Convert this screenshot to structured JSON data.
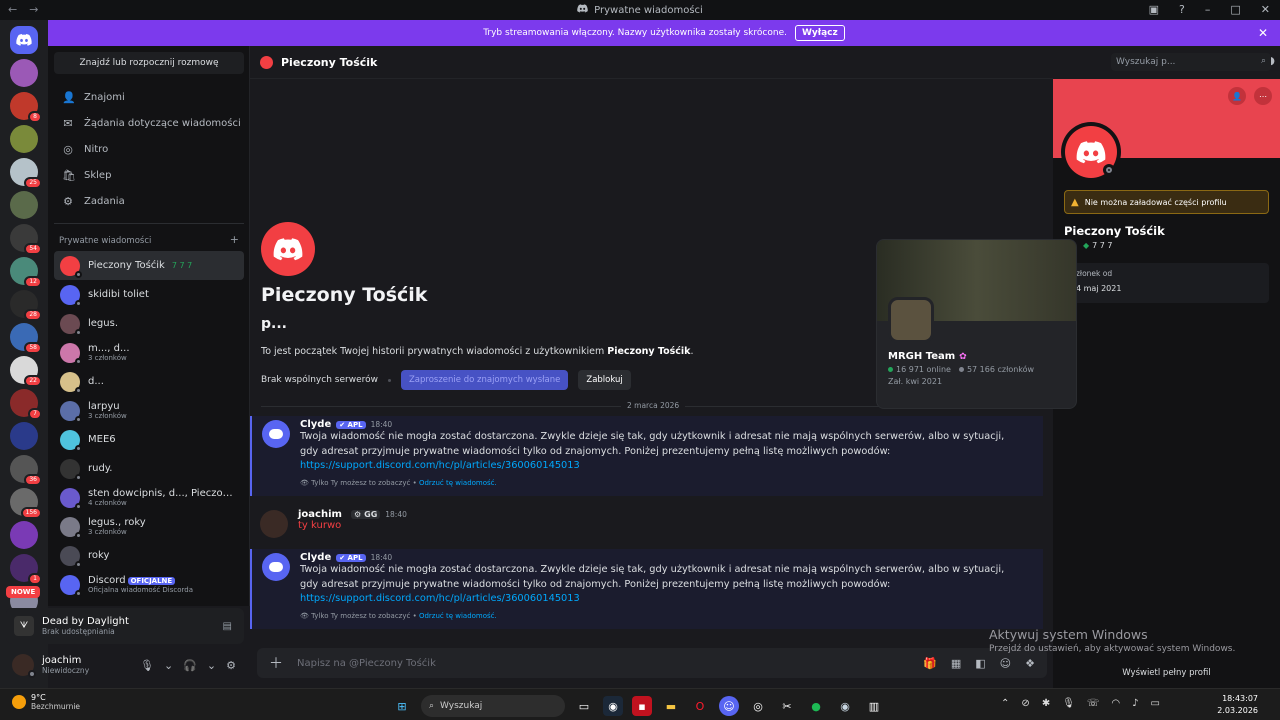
{
  "window": {
    "title": "Prywatne wiadomości"
  },
  "banner": {
    "text": "Tryb streamowania włączony. Nazwy użytkownika zostały skrócone.",
    "button": "Wyłącz"
  },
  "guild_badges": [
    "",
    "8",
    "",
    "25",
    "",
    "54",
    "12",
    "28",
    "58",
    "22",
    "7",
    "",
    "36",
    "156",
    "",
    "1",
    "",
    ""
  ],
  "new_badge": "NOWE",
  "dm_search": "Znajdź lub rozpocznij rozmowę",
  "dm_nav": [
    {
      "label": "Znajomi",
      "icon": "friends-icon",
      "glyph": "👤"
    },
    {
      "label": "Żądania dotyczące wiadomości",
      "icon": "mail-icon",
      "glyph": "✉"
    },
    {
      "label": "Nitro",
      "icon": "nitro-icon",
      "glyph": "◎"
    },
    {
      "label": "Sklep",
      "icon": "shop-icon",
      "glyph": "🛍"
    },
    {
      "label": "Zadania",
      "icon": "quests-icon",
      "glyph": "⚙"
    }
  ],
  "dm_header": {
    "label": "Prywatne wiadomości",
    "add": "+"
  },
  "dms": [
    {
      "name": "Pieczony Tośćik",
      "tag": "7 7 7",
      "sub": "",
      "color": "#f23f43",
      "active": true
    },
    {
      "name": "skidibi toliet",
      "tag": "",
      "sub": "",
      "color": "#5865f2"
    },
    {
      "name": "legus.",
      "tag": "",
      "sub": "",
      "color": "#6b4a52"
    },
    {
      "name": "m..., d...",
      "tag": "",
      "sub": "3 członków",
      "color": "#c7a"
    },
    {
      "name": "d...",
      "tag": "",
      "sub": "",
      "color": "#d6c08a"
    },
    {
      "name": "larpyu",
      "tag": "",
      "sub": "3 członków",
      "color": "#5b6ea8"
    },
    {
      "name": "MEE6",
      "tag": "",
      "sub": "",
      "color": "#4fc3dd"
    },
    {
      "name": "rudy.",
      "tag": "",
      "sub": "",
      "color": "#333"
    },
    {
      "name": "sten dowcipnis, d..., Pieczony T...",
      "tag": "",
      "sub": "4 członków",
      "color": "#6a5acd"
    },
    {
      "name": "legus., roky",
      "tag": "",
      "sub": "3 członków",
      "color": "#7a7a88"
    },
    {
      "name": "roky",
      "tag": "",
      "sub": "",
      "color": "#4a4a55"
    },
    {
      "name": "Discord",
      "tag": "",
      "official": "OFICJALNE",
      "sub": "Oficjalna wiadomość Discorda",
      "color": "#5865f2"
    }
  ],
  "activity": {
    "title": "Dead by Daylight",
    "sub": "Brak udostępniania"
  },
  "user": {
    "name": "joachim",
    "status": "Niewidoczny"
  },
  "header": {
    "name": "Pieczony Tośćik",
    "search_placeholder": "Wyszukaj p..."
  },
  "intro": {
    "name": "Pieczony Tośćik",
    "sub": "p...",
    "text_before": "To jest początek Twojej historii prywatnych wiadomości z użytkownikiem ",
    "text_name": "Pieczony Tośćik",
    "text_after": ".",
    "no_servers": "Brak wspólnych serwerów",
    "invite_sent": "Zaproszenie do znajomych wysłane",
    "block": "Zablokuj"
  },
  "date_divider": "2 marca 2026",
  "messages": [
    {
      "author": "Clyde",
      "app": "APL",
      "time": "18:40",
      "body": "Twoja wiadomość nie mogła zostać dostarczona. Zwykle dzieje się tak, gdy użytkownik i adresat nie mają wspólnych serwerów, albo w sytuacji, gdy adresat przyjmuje prywatne wiadomości tylko od znajomych. Poniżej prezentujemy pełną listę możliwych powodów:",
      "link": "https://support.discord.com/hc/pl/articles/360060145013",
      "note": "Tylko Ty możesz to zobaczyć • ",
      "note_link": "Odrzuć tę wiadomość."
    },
    {
      "author": "joachim",
      "tag": "GG",
      "time": "18:40",
      "body": "ty kurwo"
    },
    {
      "author": "Clyde",
      "app": "APL",
      "time": "18:40",
      "body": "Twoja wiadomość nie mogła zostać dostarczona. Zwykle dzieje się tak, gdy użytkownik i adresat nie mają wspólnych serwerów, albo w sytuacji, gdy adresat przyjmuje prywatne wiadomości tylko od znajomych. Poniżej prezentujemy pełną listę możliwych powodów:",
      "link": "https://support.discord.com/hc/pl/articles/360060145013",
      "note": "Tylko Ty możesz to zobaczyć • ",
      "note_link": "Odrzuć tę wiadomość."
    }
  ],
  "composer": {
    "placeholder": "Napisz na @Pieczony Tośćik"
  },
  "profile": {
    "warning": "Nie można załadować części profilu",
    "name": "Pieczony Tośćik",
    "tag": "7 7 7",
    "member_label": "złonek od",
    "member_since": "4 maj 2021",
    "footer": "Wyświetl pełny profil"
  },
  "popup": {
    "guild": "MRGH Team",
    "online": "16 971 online",
    "members": "57 166 członków",
    "since": "Zał. kwi 2021"
  },
  "watermark": {
    "title": "Aktywuj system Windows",
    "sub": "Przejdź do ustawień, aby aktywować system Windows."
  },
  "taskbar": {
    "temp": "9°C",
    "weather": "Bezchmurnie",
    "search": "Wyszukaj",
    "time": "18:43:07",
    "date": "2.03.2026"
  },
  "colors": {
    "accent": "#5865f2",
    "banner": "#7c3aed",
    "danger": "#f23f43"
  }
}
